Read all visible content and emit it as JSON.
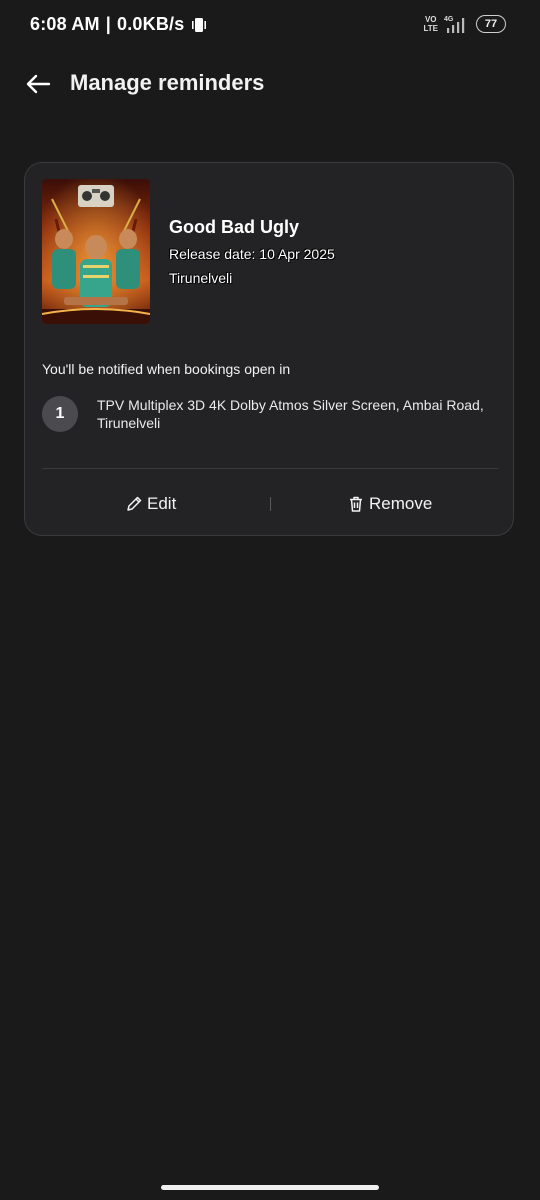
{
  "status_bar": {
    "time": "6:08 AM",
    "separator": "|",
    "speed": "0.0KB/s",
    "volte_top": "VO",
    "volte_bottom": "LTE",
    "network": "4G",
    "battery": "77"
  },
  "header": {
    "title": "Manage reminders"
  },
  "reminder": {
    "movie_title": "Good Bad Ugly",
    "release_date": "Release date: 10 Apr 2025",
    "city": "Tirunelveli",
    "notify_text": "You'll be notified when bookings open in",
    "venues": [
      {
        "number": "1",
        "name": "TPV Multiplex 3D 4K Dolby Atmos Silver Screen, Ambai Road, Tirunelveli"
      }
    ],
    "actions": {
      "edit_label": "Edit",
      "remove_label": "Remove"
    }
  },
  "colors": {
    "background": "#1a1a1b",
    "card": "#232325",
    "card_border": "#3a3a3d",
    "text": "#ffffff"
  }
}
